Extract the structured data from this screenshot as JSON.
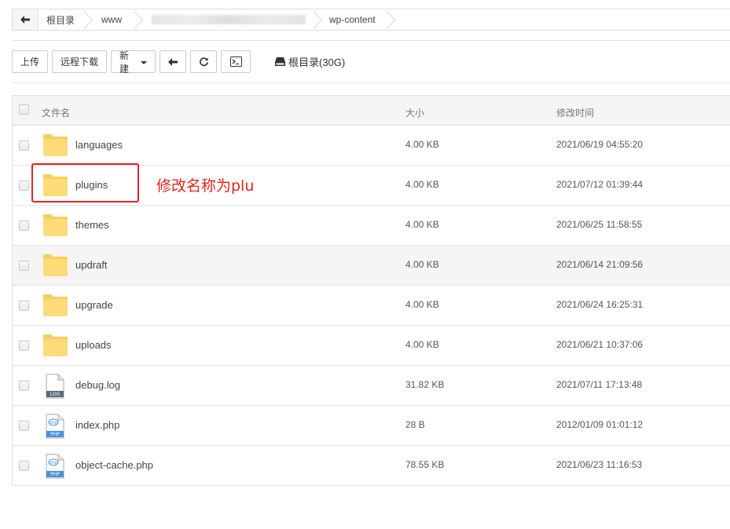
{
  "breadcrumb": {
    "back_icon": "arrow-left-icon",
    "items": [
      "根目录",
      "www",
      "",
      "wp-content"
    ]
  },
  "toolbar": {
    "upload": "上传",
    "remote_download": "远程下载",
    "new": "新建",
    "back_icon": "arrow-left-icon",
    "refresh_icon": "refresh-icon",
    "terminal_icon": "terminal-icon",
    "disk_icon": "disk-icon",
    "disk_label": "根目录(30G)"
  },
  "table": {
    "headers": {
      "name": "文件名",
      "size": "大小",
      "mtime": "修改时间"
    },
    "rows": [
      {
        "name": "languages",
        "type": "folder",
        "size": "4.00 KB",
        "mtime": "2021/06/19 04:55:20"
      },
      {
        "name": "plugins",
        "type": "folder",
        "size": "4.00 KB",
        "mtime": "2021/07/12 01:39:44"
      },
      {
        "name": "themes",
        "type": "folder",
        "size": "4.00 KB",
        "mtime": "2021/06/25 11:58:55"
      },
      {
        "name": "updraft",
        "type": "folder",
        "size": "4.00 KB",
        "mtime": "2021/06/14 21:09:56"
      },
      {
        "name": "upgrade",
        "type": "folder",
        "size": "4.00 KB",
        "mtime": "2021/06/24 16:25:31"
      },
      {
        "name": "uploads",
        "type": "folder",
        "size": "4.00 KB",
        "mtime": "2021/06/21 10:37:06"
      },
      {
        "name": "debug.log",
        "type": "log",
        "badge": "LOG",
        "size": "31.82 KB",
        "mtime": "2021/07/11 17:13:48"
      },
      {
        "name": "index.php",
        "type": "php",
        "badge": "PHP",
        "size": "28 B",
        "mtime": "2012/01/09 01:01:12"
      },
      {
        "name": "object-cache.php",
        "type": "php",
        "badge": "PHP",
        "size": "78.55 KB",
        "mtime": "2021/06/23 11:16:53"
      }
    ]
  },
  "annotation": {
    "text": "修改名称为plu",
    "color": "#e0251f"
  },
  "colors": {
    "folder": "#fddb78",
    "folder_tab": "#f6cf60",
    "accent_red": "#e0251f",
    "php_badge": "#4a90d9",
    "log_badge": "#5b6b7c"
  }
}
